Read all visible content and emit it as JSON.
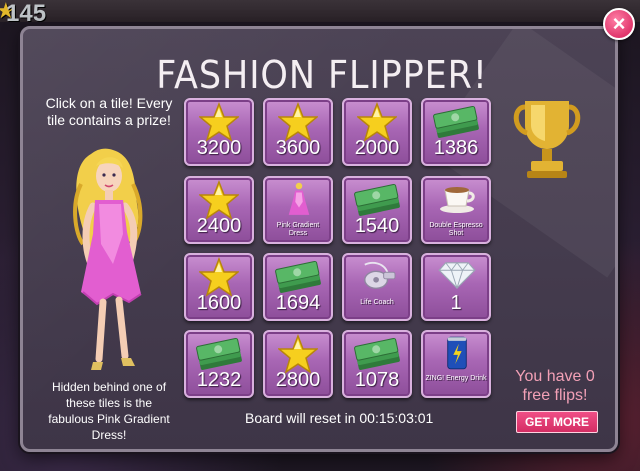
{
  "hud": {
    "level": "145"
  },
  "modal": {
    "title": "FASHION FLIPPER!",
    "intro": "Click on a tile! Every tile contains a prize!",
    "hidden_note": "Hidden behind one of these tiles is the fabulous Pink Gradient Dress!",
    "close_icon": "close-icon",
    "reset_text": "Board will reset in 00:15:03:01",
    "flips_text": "You have 0 free flips!",
    "get_more_label": "GET MORE"
  },
  "tiles": [
    {
      "icon": "star-icon",
      "value": "3200"
    },
    {
      "icon": "star-icon",
      "value": "3600"
    },
    {
      "icon": "star-icon",
      "value": "2000"
    },
    {
      "icon": "cash-icon",
      "value": "1386"
    },
    {
      "icon": "star-icon",
      "value": "2400"
    },
    {
      "icon": "dress-icon",
      "caption": "Pink Gradient Dress"
    },
    {
      "icon": "cash-icon",
      "value": "1540"
    },
    {
      "icon": "coffee-icon",
      "caption": "Double Espresso Shot"
    },
    {
      "icon": "star-icon",
      "value": "1600"
    },
    {
      "icon": "cash-icon",
      "value": "1694"
    },
    {
      "icon": "whistle-icon",
      "caption": "Life Coach"
    },
    {
      "icon": "diamond-icon",
      "value": "1"
    },
    {
      "icon": "cash-icon",
      "value": "1232"
    },
    {
      "icon": "star-icon",
      "value": "2800"
    },
    {
      "icon": "cash-icon",
      "value": "1078"
    },
    {
      "icon": "energy-drink-icon",
      "caption": "ZING! Energy Drink"
    }
  ],
  "colors": {
    "accent_pink": "#e0366c",
    "tile_purple": "#a866b4",
    "star_gold": "#f3c51a",
    "cash_green": "#3f9b4e"
  }
}
